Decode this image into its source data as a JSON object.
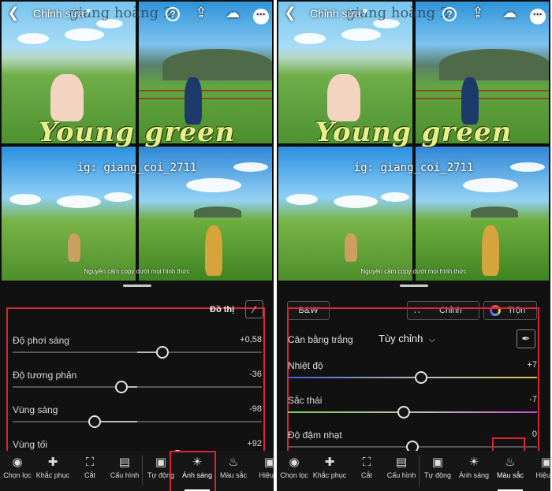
{
  "colors": {
    "accent_red": "#d9262c",
    "temp_track": "#3c63d1",
    "tint_track": "#7cc94a",
    "panel_bg": "#111111"
  },
  "photo": {
    "title_overlay": "Young green",
    "ig_handle": "ig: giang_coi_2711",
    "watermark": "Nguyên cấm copy dưới mọi hình thức",
    "bg_text": "giang hoàng 2"
  },
  "left": {
    "topbar": {
      "title": "Chỉnh sửa",
      "back_icon": "back-arrow-icon",
      "help_icon": "help-icon",
      "share_icon": "share-icon",
      "cloud_icon": "cloud-sync-icon",
      "more_icon": "more-icon"
    },
    "curve_label": "Đồ thị",
    "sliders": [
      {
        "label": "Độ phơi sáng",
        "value": "+0,58",
        "level": 0.58
      },
      {
        "label": "Độ tương phản",
        "value": "-36",
        "level": -0.36
      },
      {
        "label": "Vùng sáng",
        "value": "-98",
        "level": -0.98
      },
      {
        "label": "Vùng tối",
        "value": "+92",
        "level": 0.92
      }
    ],
    "toolbar": [
      {
        "label": "Chọn lọc",
        "icon": "selective-icon"
      },
      {
        "label": "Khắc phục",
        "icon": "heal-icon"
      },
      {
        "label": "Cắt",
        "icon": "crop-icon"
      },
      {
        "label": "Cấu hình",
        "icon": "profile-icon"
      },
      {
        "label": "Tự động",
        "icon": "auto-icon"
      },
      {
        "label": "Ánh sáng",
        "icon": "light-icon",
        "active": true
      },
      {
        "label": "Màu sắc",
        "icon": "color-icon"
      },
      {
        "label": "Hiệu ứ",
        "icon": "effects-icon"
      }
    ]
  },
  "right": {
    "topbar": {
      "title": "Chỉnh sửa"
    },
    "bw_label": "B&W",
    "mix_label": "Chỉnh",
    "blend_label": "Trộn",
    "wb_label": "Cân bằng trắng",
    "wb_value": "Tùy chỉnh",
    "sliders": [
      {
        "label": "Nhiệt độ",
        "value": "+7",
        "level": 0.07
      },
      {
        "label": "Sắc thái",
        "value": "-7",
        "level": -0.07
      },
      {
        "label": "Độ đậm nhạt",
        "value": "0",
        "level": 0
      }
    ],
    "toolbar": [
      {
        "label": "Chọn lọc",
        "icon": "selective-icon"
      },
      {
        "label": "Khắc phục",
        "icon": "heal-icon"
      },
      {
        "label": "Cắt",
        "icon": "crop-icon"
      },
      {
        "label": "Cấu hình",
        "icon": "profile-icon"
      },
      {
        "label": "Tự động",
        "icon": "auto-icon"
      },
      {
        "label": "Ánh sáng",
        "icon": "light-icon"
      },
      {
        "label": "Màu sắc",
        "icon": "color-icon",
        "active": true
      },
      {
        "label": "Hiệu ứ",
        "icon": "effects-icon"
      }
    ]
  }
}
